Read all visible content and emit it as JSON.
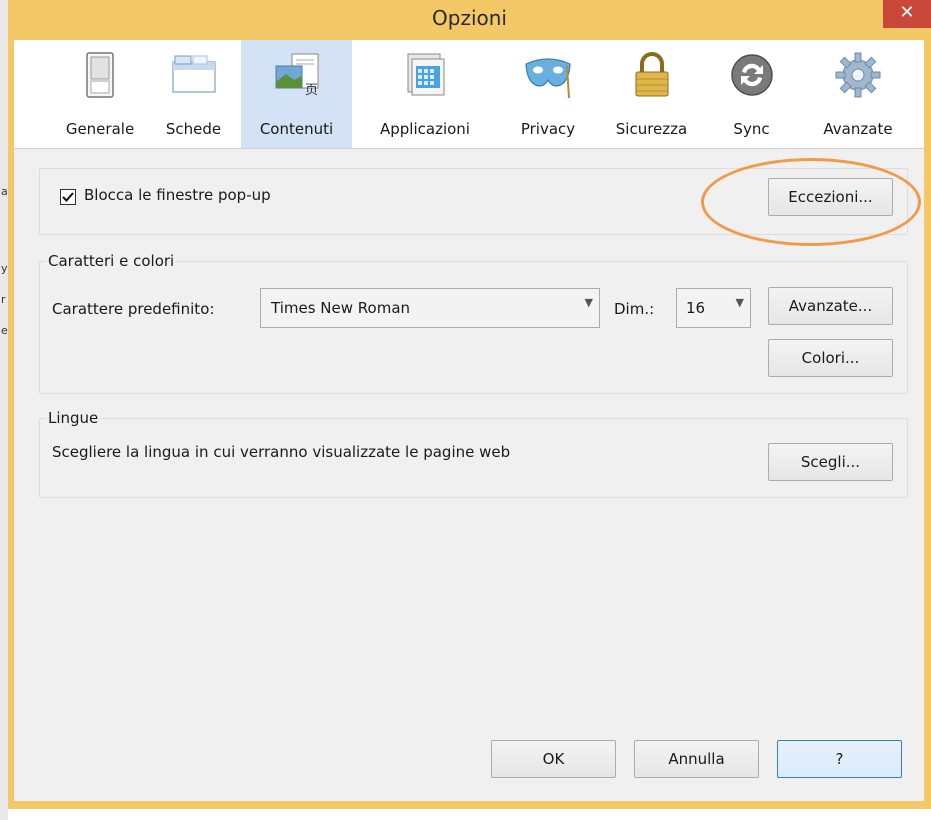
{
  "window": {
    "title": "Opzioni",
    "close_glyph": "✕"
  },
  "tabs": [
    {
      "label": "Generale",
      "icon": "switch-icon"
    },
    {
      "label": "Schede",
      "icon": "tabs-window-icon"
    },
    {
      "label": "Contenuti",
      "icon": "content-icon",
      "selected": true
    },
    {
      "label": "Applicazioni",
      "icon": "applications-icon"
    },
    {
      "label": "Privacy",
      "icon": "privacy-mask-icon"
    },
    {
      "label": "Sicurezza",
      "icon": "padlock-icon"
    },
    {
      "label": "Sync",
      "icon": "sync-icon"
    },
    {
      "label": "Avanzate",
      "icon": "gear-icon"
    }
  ],
  "popup": {
    "checkbox_label": "Blocca le finestre pop-up",
    "checked": true,
    "exceptions_button": "Eccezioni..."
  },
  "fonts": {
    "legend": "Caratteri e colori",
    "default_font_label": "Carattere predefinito:",
    "default_font_value": "Times New Roman",
    "size_label": "Dim.:",
    "size_value": "16",
    "advanced_button": "Avanzate...",
    "colors_button": "Colori..."
  },
  "languages": {
    "legend": "Lingue",
    "description": "Scegliere la lingua in cui verranno visualizzate le pagine web",
    "choose_button": "Scegli..."
  },
  "footer": {
    "ok": "OK",
    "cancel": "Annulla",
    "help": "?"
  },
  "colors": {
    "window_frame": "#f4c867",
    "selected_tab": "#d3e2f4",
    "annotation": "#f09a4a"
  }
}
